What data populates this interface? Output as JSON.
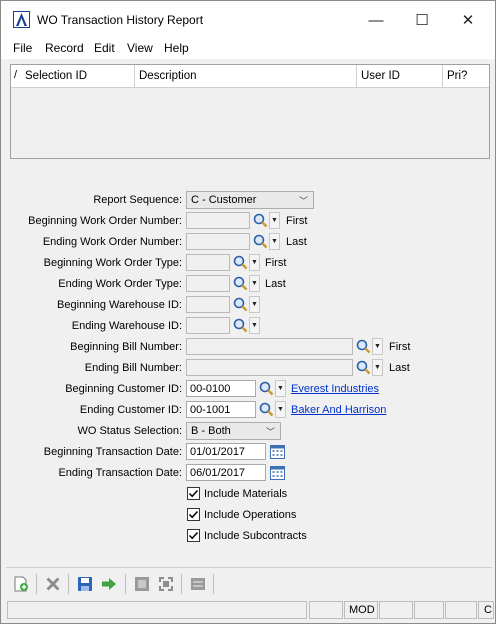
{
  "window": {
    "title": "WO Transaction History Report",
    "minimize_glyph": "—",
    "maximize_glyph": "☐",
    "close_glyph": "✕"
  },
  "menu": [
    "File",
    "Record",
    "Edit",
    "View",
    "Help"
  ],
  "grid": {
    "columns": [
      "Selection ID",
      "Description",
      "User ID",
      "Pri?"
    ],
    "rows": []
  },
  "form": {
    "report_sequence": {
      "label": "Report Sequence:",
      "value": "C - Customer"
    },
    "beg_work_order": {
      "label": "Beginning Work Order Number:",
      "value": "",
      "hint": "First"
    },
    "end_work_order": {
      "label": "Ending Work Order Number:",
      "value": "",
      "hint": "Last"
    },
    "beg_wo_type": {
      "label": "Beginning Work Order Type:",
      "value": "",
      "hint": "First"
    },
    "end_wo_type": {
      "label": "Ending Work Order Type:",
      "value": "",
      "hint": "Last"
    },
    "beg_warehouse": {
      "label": "Beginning Warehouse ID:",
      "value": ""
    },
    "end_warehouse": {
      "label": "Ending Warehouse ID:",
      "value": ""
    },
    "beg_bill": {
      "label": "Beginning Bill Number:",
      "value": "",
      "hint": "First"
    },
    "end_bill": {
      "label": "Ending Bill Number:",
      "value": "",
      "hint": "Last"
    },
    "beg_customer": {
      "label": "Beginning Customer ID:",
      "value": "00-0100",
      "link": "Everest Industries"
    },
    "end_customer": {
      "label": "Ending Customer ID:",
      "value": "00-1001",
      "link": "Baker And Harrison"
    },
    "wo_status": {
      "label": "WO Status Selection:",
      "value": "B - Both"
    },
    "beg_trans_date": {
      "label": "Beginning Transaction Date:",
      "value": "01/01/2017"
    },
    "end_trans_date": {
      "label": "Ending Transaction Date:",
      "value": "06/01/2017"
    },
    "include_materials": {
      "label": "Include Materials",
      "checked": true
    },
    "include_operations": {
      "label": "Include Operations",
      "checked": true
    },
    "include_subcontracts": {
      "label": "Include Subcontracts",
      "checked": true
    }
  },
  "toolbar": {
    "icons": [
      "new-icon",
      "delete-icon",
      "save-icon",
      "proceed-icon",
      "print-icon",
      "expand-icon",
      "list-icon"
    ]
  },
  "status_bar": {
    "mode": "MOD",
    "last_panel": "C"
  }
}
